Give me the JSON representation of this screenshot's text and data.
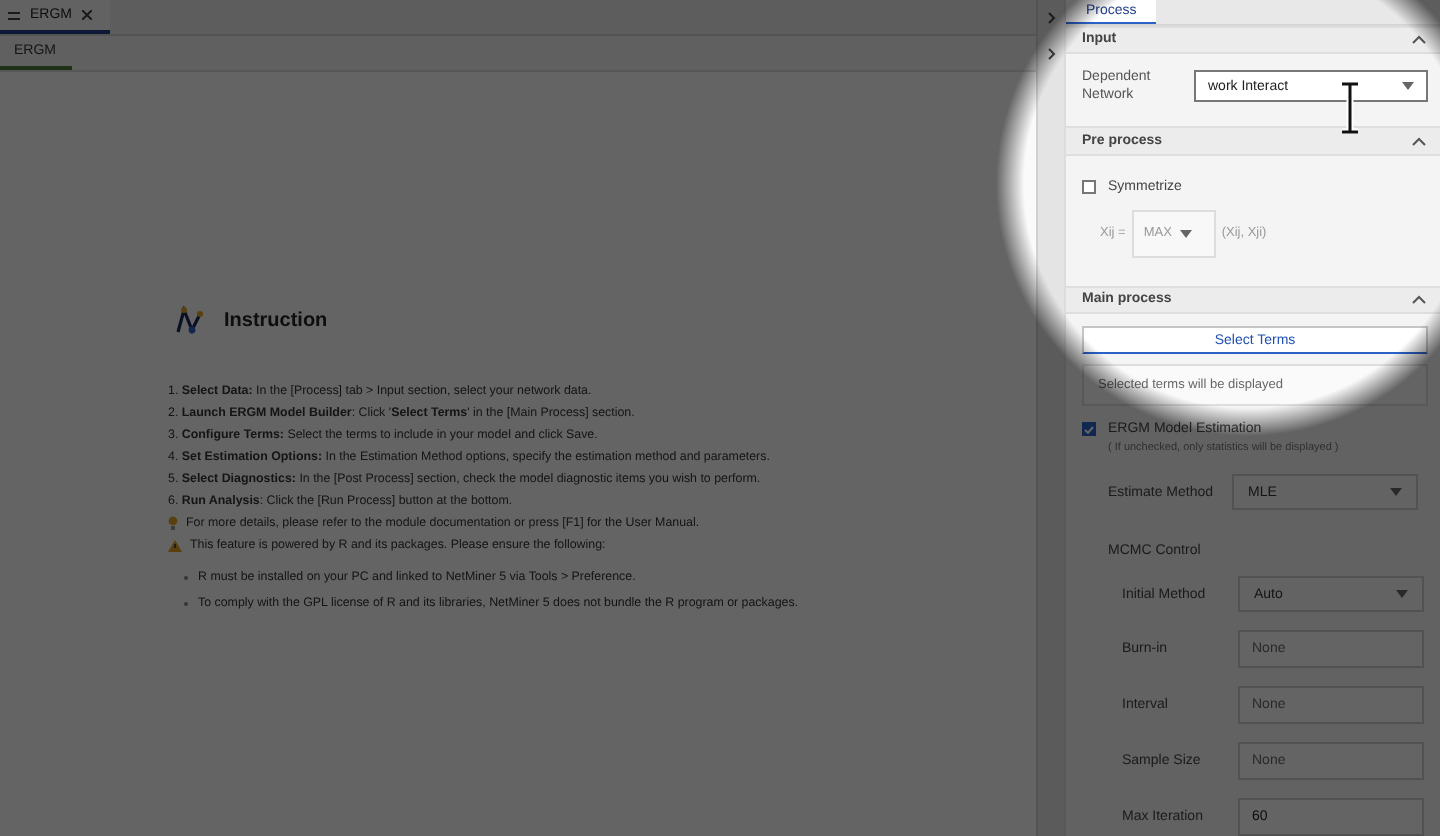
{
  "doc_tabs": [
    {
      "label": "ERGM",
      "selected": true
    }
  ],
  "sub_tabs": [
    {
      "label": "ERGM",
      "selected": true
    }
  ],
  "instruction": {
    "title": "Instruction",
    "steps": [
      "1. **Select Data:** In the [Process] tab > Input section, select your network data.",
      "2. **Launch ERGM Model Builder**: Click '**Select Terms**' in the [Main Process] section.",
      "3. **Configure Terms:** Select the terms to include in your model and click Save.",
      "4. **Set Estimation Options:** In the Estimation Method options, specify the estimation method and parameters.",
      "5. **Select Diagnostics:** In the [Post Process] section, check the model diagnostic items you wish to perform.",
      "6. **Run Analysis**: Click the [Run Process] button at the bottom."
    ],
    "notes": [
      {
        "kind": "tip",
        "text": "For more details, please refer to the module documentation or press [F1] for the User Manual."
      },
      {
        "kind": "warning",
        "text": "This feature is powered by R and its packages. Please ensure the following:"
      }
    ],
    "bullets": [
      "R must be installed on your PC and linked to NetMiner 5 via Tools > Preference.",
      "To comply with the GPL license of R and its libraries, NetMiner 5 does not bundle the R program or packages."
    ]
  },
  "panel_tabs": [
    {
      "label": "Process",
      "selected": true
    }
  ],
  "input": {
    "title": "Input",
    "expanded": true,
    "label": "Dependent Network",
    "value": "work Interact"
  },
  "pre_process": {
    "title": "Pre process",
    "expanded": true,
    "symmetrize": {
      "label": "Symmetrize",
      "checked": false
    },
    "formula_left": "Xij =",
    "method": {
      "value": "MAX",
      "disabled": true
    },
    "formula_right": "(Xij, Xji)"
  },
  "main_process": {
    "title": "Main process",
    "expanded": true,
    "button": "Select Terms",
    "terms_placeholder": "Selected terms will be displayed",
    "estimation": {
      "label": "ERGM Model Estimation",
      "checked": true,
      "note": "( If unchecked, only statistics will be displayed )"
    },
    "estimate_method": {
      "label": "Estimate Method",
      "value": "MLE"
    },
    "mcmc_title": "MCMC Control",
    "mcmc_fields": [
      {
        "kind": "select",
        "label": "Initial Method",
        "value": "Auto"
      },
      {
        "kind": "input",
        "label": "Burn-in",
        "placeholder": "None"
      },
      {
        "kind": "input",
        "label": "Interval",
        "placeholder": "None"
      },
      {
        "kind": "input",
        "label": "Sample Size",
        "placeholder": "None"
      },
      {
        "kind": "input",
        "label": "Max Iteration",
        "value": "60"
      }
    ]
  }
}
